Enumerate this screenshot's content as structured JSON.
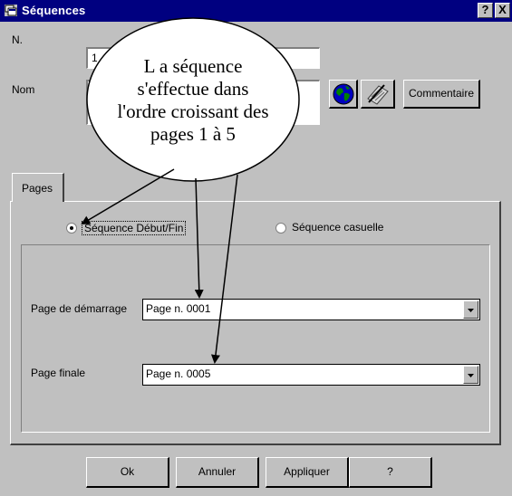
{
  "window": {
    "title": "Séquences",
    "help_button": "?",
    "close_button": "X"
  },
  "fields": {
    "number_label": "N.",
    "number_value": "1",
    "name_label": "Nom",
    "comment_button": "Commentaire"
  },
  "tabs": [
    {
      "label": "Pages"
    }
  ],
  "sequence": {
    "option_start_end": "Séquence Début/Fin",
    "option_random": "Séquence casuelle",
    "selected": "Séquence Début/Fin"
  },
  "pages": {
    "start_label": "Page de démarrage",
    "start_value": "Page n. 0001",
    "end_label": "Page finale",
    "end_value": "Page n. 0005"
  },
  "buttons": {
    "ok": "Ok",
    "cancel": "Annuler",
    "apply": "Appliquer",
    "help": "?"
  },
  "callout": {
    "line1": "L a séquence",
    "line2": "s'effectue dans",
    "line3": "l'ordre croissant des",
    "line4": "pages 1 à 5"
  },
  "icons": {
    "title": "sequences-icon",
    "globe": "globe-icon",
    "edit": "pencil-document-icon",
    "dropdown": "chevron-down-icon"
  },
  "colors": {
    "titlebar": "#000080",
    "dialog_face": "#c0c0c0",
    "globe_sea": "#0000c0",
    "globe_land": "#008000"
  }
}
